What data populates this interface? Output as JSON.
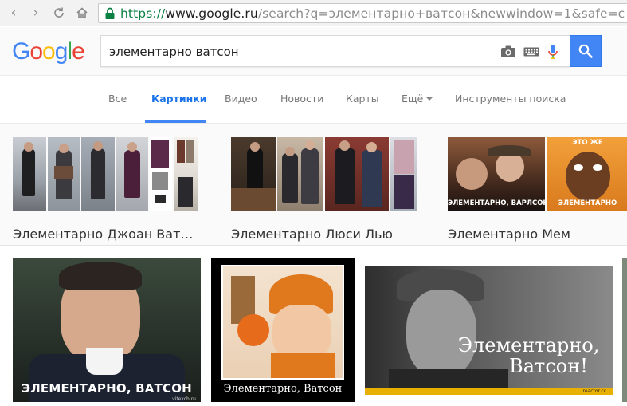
{
  "browser": {
    "url_scheme": "https://",
    "url_host": "www.google.ru",
    "url_rest": "/search?q=элементарно+ватсон&newwindow=1&safe=c"
  },
  "search": {
    "query": "элементарно ватсон"
  },
  "logo": {
    "letters": [
      "G",
      "o",
      "o",
      "g",
      "l",
      "e"
    ],
    "colors": [
      "#4285f4",
      "#ea4335",
      "#fbbc05",
      "#4285f4",
      "#34a853",
      "#ea4335"
    ]
  },
  "tabs": [
    {
      "label": "Все"
    },
    {
      "label": "Картинки"
    },
    {
      "label": "Видео"
    },
    {
      "label": "Новости"
    },
    {
      "label": "Карты"
    },
    {
      "label": "Ещё"
    },
    {
      "label": "Инструменты поиска"
    }
  ],
  "related": [
    {
      "label": "Элементарно Джоан Ват…"
    },
    {
      "label": "Элементарно Люси Лью"
    },
    {
      "label": "Элементарно Мем",
      "captions": [
        "ЭЛЕМЕНТАРНО, ВАРЛСОН",
        "ЭТО ЖЕ",
        "ЭЛЕМЕНТАРНО"
      ]
    }
  ],
  "results": [
    {
      "caption": "ЭЛЕМЕНТАРНО, ВАТСОН",
      "watermark": "vitexch.ru"
    },
    {
      "caption": "Элементарно, Ватсон"
    },
    {
      "caption_line1": "Элементарно,",
      "caption_line2": "Ватсон!",
      "watermark": "reactor.cc"
    }
  ],
  "colors": {
    "accent": "#4285f4",
    "active_tab": "#1a73e8",
    "url_green": "#0b8043"
  }
}
